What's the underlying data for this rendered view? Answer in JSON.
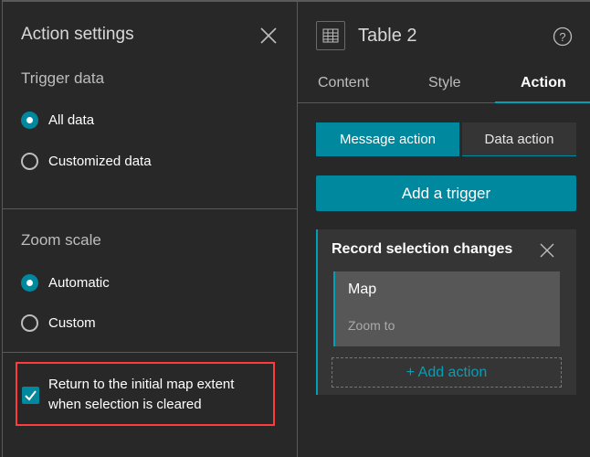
{
  "action_settings": {
    "title": "Action settings",
    "trigger_data": {
      "label": "Trigger data",
      "options": [
        "All data",
        "Customized data"
      ],
      "selected": "All data"
    },
    "zoom_scale": {
      "label": "Zoom scale",
      "options": [
        "Automatic",
        "Custom"
      ],
      "selected": "Automatic"
    },
    "return_extent": {
      "label_line1": "Return to the initial map extent",
      "label_line2": "when selection is cleared",
      "checked": true
    }
  },
  "widget": {
    "title": "Table 2",
    "tabs": [
      "Content",
      "Style",
      "Action"
    ],
    "active_tab": "Action",
    "action_types": [
      "Message action",
      "Data action"
    ],
    "add_trigger": "Add a trigger",
    "trigger": {
      "title": "Record selection changes",
      "action": {
        "target": "Map",
        "type": "Zoom to"
      },
      "add_action": "+ Add action"
    }
  },
  "colors": {
    "accent": "#00889e",
    "highlight": "#ff3b3b"
  }
}
